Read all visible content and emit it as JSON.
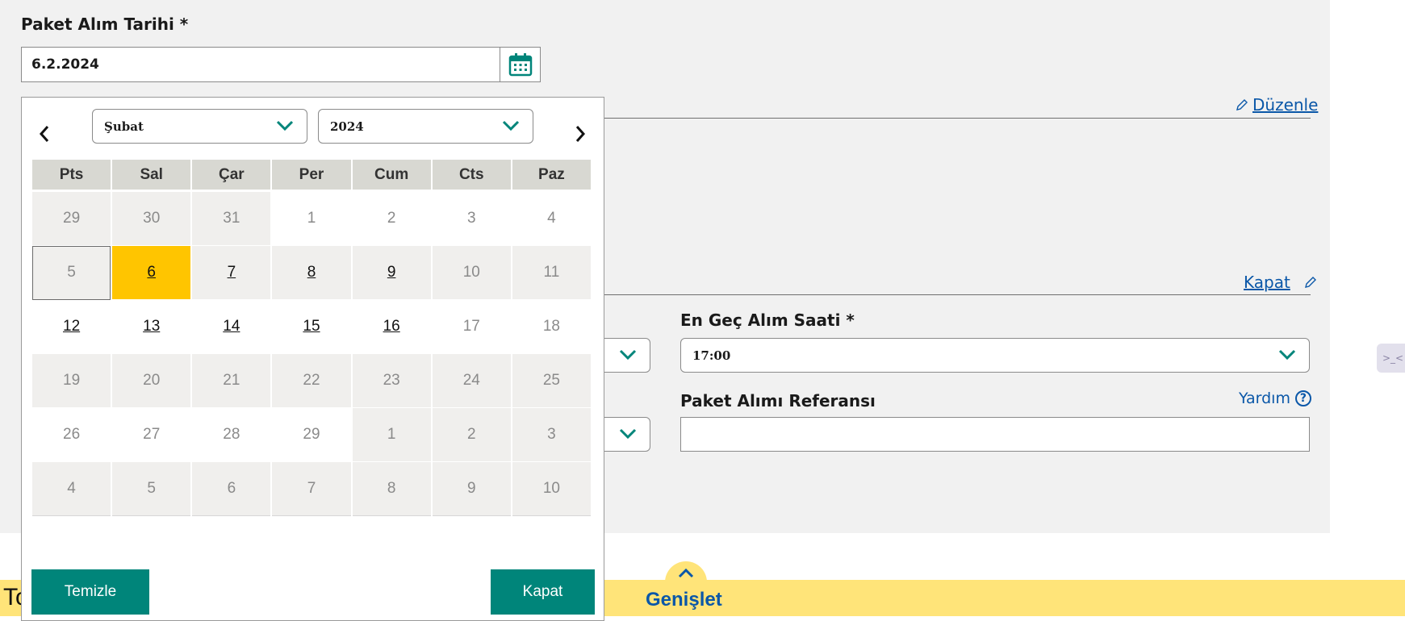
{
  "form": {
    "pickup_date_label": "Paket Alım Tarihi *",
    "pickup_date_value": "6.2.2024",
    "edit_link": "Düzenle",
    "close_link": "Kapat",
    "latest_time_label": "En Geç Alım Saati *",
    "latest_time_value": "17:00",
    "reference_label": "Paket Alımı Referansı",
    "reference_value": "",
    "help_link": "Yardım",
    "help_symbol": "?"
  },
  "calendar": {
    "month": "Şubat",
    "year": "2024",
    "weekdays": [
      "Pts",
      "Sal",
      "Çar",
      "Per",
      "Cum",
      "Cts",
      "Paz"
    ],
    "weeks": [
      [
        "29",
        "30",
        "31",
        "1",
        "2",
        "3",
        "4"
      ],
      [
        "5",
        "6",
        "7",
        "8",
        "9",
        "10",
        "11"
      ],
      [
        "12",
        "13",
        "14",
        "15",
        "16",
        "17",
        "18"
      ],
      [
        "19",
        "20",
        "21",
        "22",
        "23",
        "24",
        "25"
      ],
      [
        "26",
        "27",
        "28",
        "29",
        "1",
        "2",
        "3"
      ],
      [
        "4",
        "5",
        "6",
        "7",
        "8",
        "9",
        "10"
      ]
    ],
    "selected_day": "6",
    "clear_button": "Temizle",
    "close_button": "Kapat"
  },
  "bottom": {
    "left_text": "To",
    "expand_label": "Genişlet"
  },
  "colors": {
    "accent": "#00857a",
    "selected": "#ffc500",
    "link": "#0a57a8",
    "bar": "#ffe479"
  }
}
